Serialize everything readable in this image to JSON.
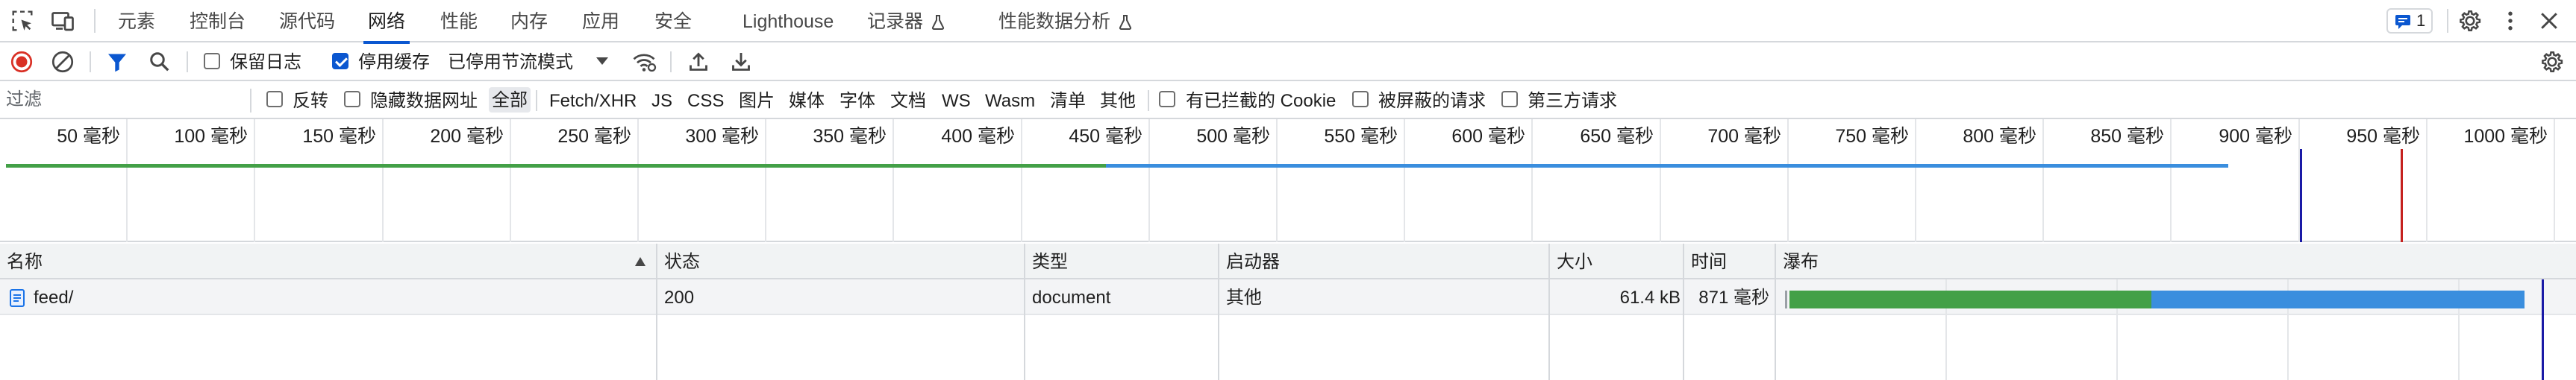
{
  "tabs": [
    {
      "label": "元素"
    },
    {
      "label": "控制台"
    },
    {
      "label": "源代码"
    },
    {
      "label": "网络"
    },
    {
      "label": "性能"
    },
    {
      "label": "内存"
    },
    {
      "label": "应用"
    },
    {
      "label": "安全"
    },
    {
      "label": "Lighthouse"
    },
    {
      "label": "记录器"
    },
    {
      "label": "性能数据分析"
    }
  ],
  "active_tab": "网络",
  "issues_count": "1",
  "toolbar": {
    "preserve_log": {
      "label": "保留日志",
      "checked": false
    },
    "disable_cache": {
      "label": "停用缓存",
      "checked": true
    },
    "throttle": {
      "value": "已停用节流模式"
    }
  },
  "filter": {
    "placeholder": "过滤",
    "value": "",
    "invert": {
      "label": "反转",
      "checked": false
    },
    "hide_data_urls": {
      "label": "隐藏数据网址",
      "checked": false
    },
    "types": [
      "全部",
      "Fetch/XHR",
      "JS",
      "CSS",
      "图片",
      "媒体",
      "字体",
      "文档",
      "WS",
      "Wasm",
      "清单",
      "其他"
    ],
    "selected_type": "全部",
    "blocked_cookies": {
      "label": "有已拦截的 Cookie",
      "checked": false
    },
    "blocked_requests": {
      "label": "被屏蔽的请求",
      "checked": false
    },
    "third_party": {
      "label": "第三方请求",
      "checked": false
    }
  },
  "overview": {
    "tick_labels": [
      "50 毫秒",
      "100 毫秒",
      "150 毫秒",
      "200 毫秒",
      "250 毫秒",
      "300 毫秒",
      "350 毫秒",
      "400 毫秒",
      "450 毫秒",
      "500 毫秒",
      "550 毫秒",
      "600 毫秒",
      "650 毫秒",
      "700 毫秒",
      "750 毫秒",
      "800 毫秒",
      "850 毫秒",
      "900 毫秒",
      "950 毫秒",
      "1000 毫秒"
    ]
  },
  "table": {
    "headers": {
      "name": "名称",
      "status": "状态",
      "type": "类型",
      "initiator": "启动器",
      "size": "大小",
      "time": "时间",
      "waterfall": "瀑布"
    },
    "sort": {
      "column": "名称",
      "direction": "ascending"
    },
    "rows": [
      {
        "name": "feed/",
        "status": "200",
        "type": "document",
        "initiator": "其他",
        "size": "61.4 kB",
        "time": "871 毫秒"
      }
    ]
  },
  "colors": {
    "accent": "#0b57d0",
    "record_red": "#d93025",
    "waiting_green": "#43a047",
    "download_blue": "#3a8ede",
    "dom_loaded_blue": "#1a1aa6",
    "load_red": "#c5221f"
  },
  "icons": [
    "inspect-icon",
    "device-toolbar-icon",
    "flask-icon",
    "message-icon",
    "gear-icon",
    "more-vert-icon",
    "close-icon",
    "record-icon",
    "clear-icon",
    "filter-icon",
    "search-icon",
    "dropdown-arrow-icon",
    "network-conditions-icon",
    "import-har-icon",
    "export-har-icon",
    "network-settings-icon",
    "document-icon",
    "sort-ascending-icon"
  ]
}
